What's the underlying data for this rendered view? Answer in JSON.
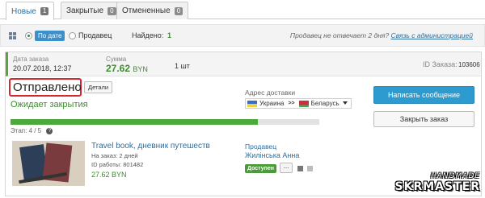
{
  "tabs": [
    {
      "label": "Новые",
      "count": "1"
    },
    {
      "label": "Закрытые",
      "count": "0"
    },
    {
      "label": "Отмененные",
      "count": "0"
    }
  ],
  "filter": {
    "sort_by_date": "По дате",
    "sort_by_seller": "Продавец",
    "found_label": "Найдено:",
    "found_count": "1",
    "note": "Продавец не отвечает 2 дня?",
    "admin_link": "Связь с администрацией"
  },
  "order": {
    "date_label": "Дата заказа",
    "date_value": "20.07.2018, 12:37",
    "sum_label": "Сумма",
    "sum_value": "27.62",
    "sum_currency": "BYN",
    "qty": "1 шт",
    "id_label": "ID Заказа:",
    "id_value": "103606",
    "status": "Отправлено",
    "details_button": "Детали",
    "waiting": "Ожидает закрытия",
    "address_label": "Адрес доставки",
    "from_country": "Украина",
    "arrows": ">>",
    "to_country": "Беларусь",
    "stage_label": "Этап:",
    "stage_value": "4 / 5",
    "progress_fraction": 0.8,
    "write_message_button": "Написать сообщение",
    "close_order_button": "Закрыть заказ",
    "question_icon": "?"
  },
  "product": {
    "title": "Travel book, дневник путешеств",
    "order_time": "На заказ: 2 дней",
    "work_id": "ID работы: 801482",
    "price": "27.62 BYN",
    "seller_label": "Продавец",
    "seller_name": "Жилінська Анна",
    "availability": "Доступен",
    "more": "..."
  },
  "watermark": {
    "line1": "HANDMADE",
    "line2": "SKRMASTER"
  },
  "colors": {
    "accent_green": "#3d8b2f",
    "accent_blue": "#2e9bd0",
    "status_border": "#d4282f"
  }
}
